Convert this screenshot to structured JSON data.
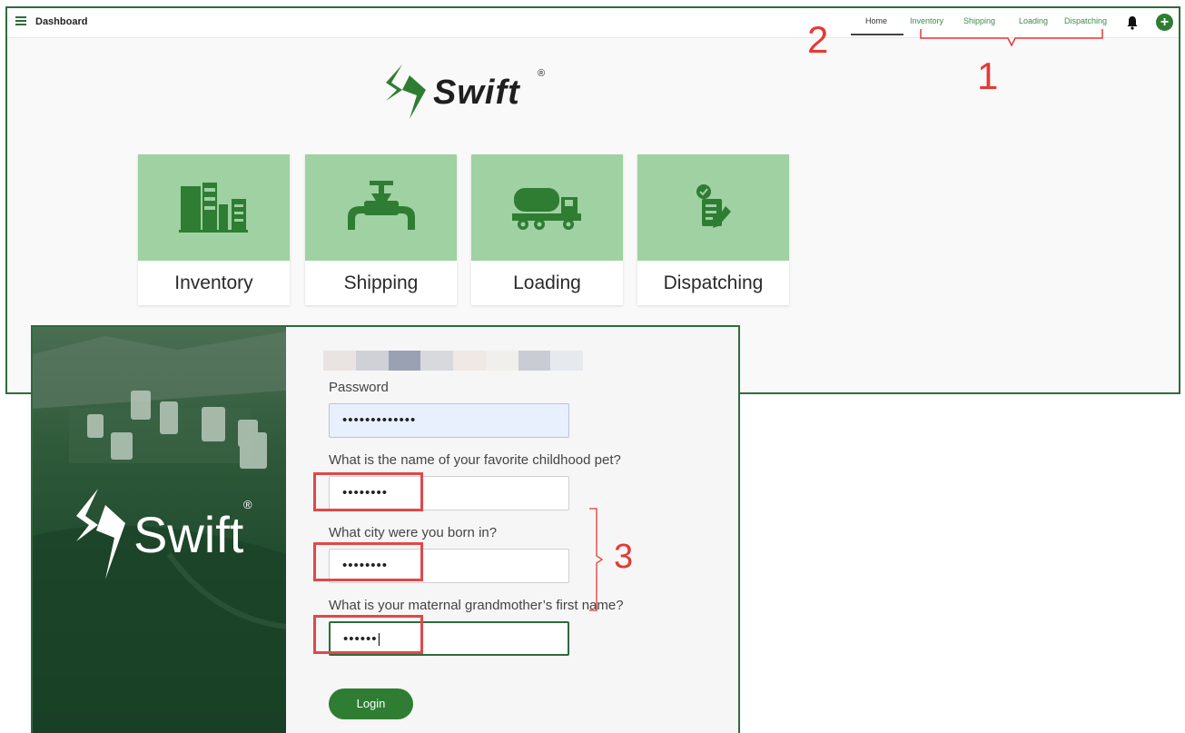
{
  "dashboard": {
    "title": "Dashboard",
    "nav": [
      "Home",
      "Inventory",
      "Shipping",
      "Loading",
      "Dispatching"
    ],
    "brand": "Swift",
    "reg_mark": "®",
    "tiles": [
      {
        "label": "Inventory",
        "icon": "storage-tanks-icon"
      },
      {
        "label": "Shipping",
        "icon": "pipeline-valve-icon"
      },
      {
        "label": "Loading",
        "icon": "tanker-truck-icon"
      },
      {
        "label": "Dispatching",
        "icon": "checklist-icon"
      }
    ],
    "tile_color": "#9fd1a2",
    "accent": "#2e7d32"
  },
  "login": {
    "brand": "Swift",
    "reg_mark": "®",
    "password_label": "Password",
    "password_value": "•••••••••••••",
    "questions": [
      {
        "label": "What is the name of your favorite childhood pet?",
        "value": "••••••••"
      },
      {
        "label": "What city were you born in?",
        "value": "••••••••"
      },
      {
        "label": "What is your maternal grandmother’s first name?",
        "value": "••••••|"
      }
    ],
    "login_button": "Login"
  },
  "annotations": {
    "one": "1",
    "two": "2",
    "three": "3",
    "color": "#e53935"
  }
}
